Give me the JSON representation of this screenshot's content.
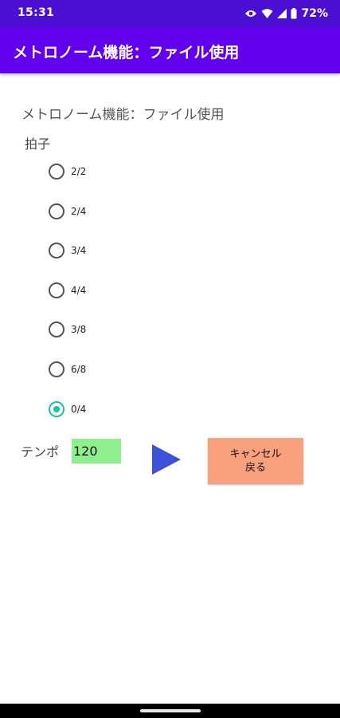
{
  "status_bar": {
    "time": "15:31",
    "battery": "72%"
  },
  "app_bar": {
    "title": "メトロノーム機能：ファイル使用"
  },
  "main": {
    "heading": "メトロノーム機能：ファイル使用",
    "beat_label": "拍子",
    "beat_options": [
      {
        "label": "2/2",
        "checked": false
      },
      {
        "label": "2/4",
        "checked": false
      },
      {
        "label": "3/4",
        "checked": false
      },
      {
        "label": "4/4",
        "checked": false
      },
      {
        "label": "3/8",
        "checked": false
      },
      {
        "label": "6/8",
        "checked": false
      },
      {
        "label": "0/4",
        "checked": true
      }
    ],
    "tempo_label": "テンポ",
    "tempo_value": "120",
    "cancel_button": {
      "line1": "キャンセル",
      "line2": "戻る"
    }
  },
  "colors": {
    "status_bar": "#4b0fd1",
    "app_bar": "#6200ee",
    "radio_accent": "#18c3a8",
    "tempo_input_bg": "#8df08d",
    "play_icon": "#3f51d6",
    "cancel_button_bg": "#f9a07c"
  }
}
